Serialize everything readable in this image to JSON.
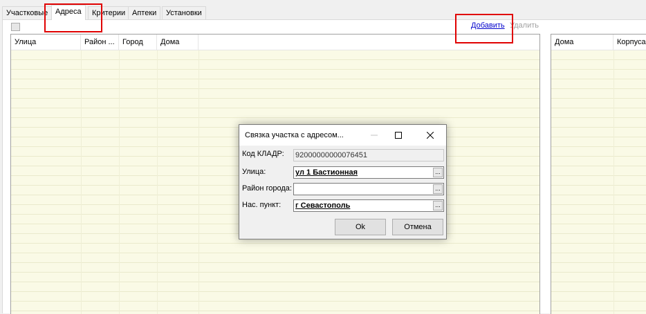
{
  "tabs": [
    {
      "label": "Участковые"
    },
    {
      "label": "Адреса"
    },
    {
      "label": "Критерии"
    },
    {
      "label": "Аптеки"
    },
    {
      "label": "Установки"
    }
  ],
  "toolbar": {
    "add_label": "Добавить",
    "delete_label": "Удалить"
  },
  "left_grid": {
    "columns": [
      "Улица",
      "Район ...",
      "Город",
      "Дома"
    ]
  },
  "right_grid": {
    "columns": [
      "Дома",
      "Корпуса"
    ]
  },
  "dialog": {
    "title": "Связка участка с адресом...",
    "fields": [
      {
        "label": "Код КЛАДР:",
        "value": "92000000000076451"
      },
      {
        "label": "Улица:",
        "value": "ул 1 Бастионная"
      },
      {
        "label": "Район города:",
        "value": ""
      },
      {
        "label": "Нас. пункт:",
        "value": "г Севастополь"
      }
    ],
    "ok_label": "Ok",
    "cancel_label": "Отмена"
  },
  "colors": {
    "highlight": "#e00000",
    "grid_bg": "#fafae6",
    "link": "#0000cc"
  }
}
